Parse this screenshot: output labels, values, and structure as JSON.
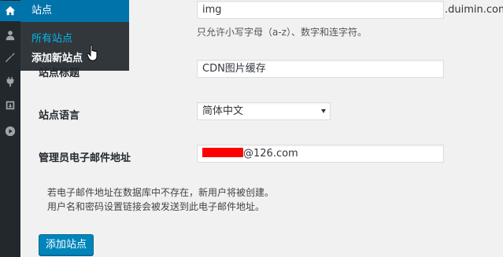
{
  "sidebar": {
    "icons": [
      "home-icon",
      "users-icon",
      "tools-icon",
      "plugins-icon",
      "import-icon",
      "play-icon"
    ],
    "flyout": {
      "title": "站点",
      "items": [
        {
          "label": "所有站点",
          "state": "current"
        },
        {
          "label": "添加新站点",
          "state": "hover"
        }
      ]
    }
  },
  "form": {
    "site_address": {
      "value": "img",
      "suffix": ".duimin.com",
      "hint": "只允许小写字母（a-z）、数字和连字符。"
    },
    "site_title": {
      "label": "站点标题",
      "value": "CDN图片缓存"
    },
    "site_language": {
      "label": "站点语言",
      "value": "简体中文"
    },
    "admin_email": {
      "label": "管理员电子邮件地址",
      "value_suffix": "@126.com"
    },
    "note_lines": [
      "若电子邮件地址在数据库中不存在，新用户将被创建。",
      "用户名和密码设置链接会被发送到此电子邮件地址。"
    ],
    "submit_label": "添加站点"
  },
  "colors": {
    "accent": "#0073aa",
    "sidebar": "#23282d",
    "submenu": "#32373c",
    "current_link": "#00b9eb",
    "redaction": "#ff0000"
  }
}
